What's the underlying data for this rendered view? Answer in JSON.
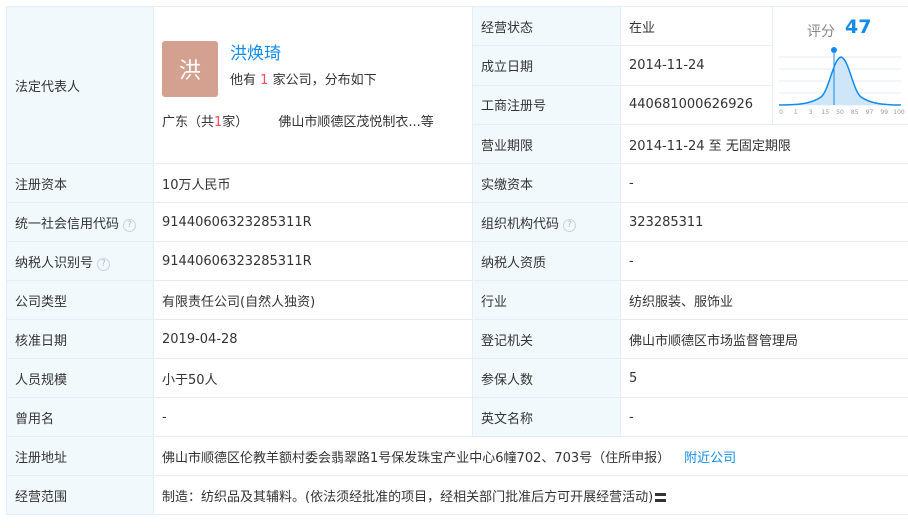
{
  "legal_rep": {
    "label": "法定代表人",
    "avatar_char": "洪",
    "name": "洪焕琦",
    "desc_prefix": "他有",
    "desc_count": "1",
    "desc_suffix": "家公司，分布如下",
    "province_prefix": "广东（共",
    "province_count": "1",
    "province_suffix": "家）",
    "company": "佛山市顺德区茂悦制衣...等"
  },
  "score": {
    "label": "评分",
    "value": "47",
    "ticks": [
      "0",
      "1",
      "3",
      "15",
      "50",
      "85",
      "97",
      "99",
      "100"
    ]
  },
  "fields": {
    "status_label": "经营状态",
    "status": "在业",
    "est_date_label": "成立日期",
    "est_date": "2014-11-24",
    "reg_no_label": "工商注册号",
    "reg_no": "440681000626926",
    "term_label": "营业期限",
    "term": "2014-11-24  至  无固定期限",
    "capital_label": "注册资本",
    "capital": "10万人民币",
    "paid_label": "实缴资本",
    "paid": "-",
    "credit_label": "统一社会信用代码",
    "credit": "91440606323285311R",
    "org_label": "组织机构代码",
    "org": "323285311",
    "tax_label": "纳税人识别号",
    "tax": "91440606323285311R",
    "taxq_label": "纳税人资质",
    "taxq": "-",
    "type_label": "公司类型",
    "type": "有限责任公司(自然人独资)",
    "industry_label": "行业",
    "industry": "纺织服装、服饰业",
    "approve_label": "核准日期",
    "approve": "2019-04-28",
    "authority_label": "登记机关",
    "authority": "佛山市顺德区市场监督管理局",
    "staff_label": "人员规模",
    "staff": "小于50人",
    "insured_label": "参保人数",
    "insured": "5",
    "former_label": "曾用名",
    "former": "-",
    "english_label": "英文名称",
    "english": "-",
    "address_label": "注册地址",
    "address": "佛山市顺德区伦教羊额村委会翡翠路1号保发珠宝产业中心6幢702、703号（住所申报）",
    "nearby_link": "附近公司",
    "scope_label": "经营范围",
    "scope": "制造：纺织品及其辅料。(依法须经批准的项目，经相关部门批准后方可开展经营活动)"
  },
  "help_icon": "question-circle-icon",
  "colors": {
    "accent": "#128bed",
    "highlight": "#fd485e",
    "label_bg": "#f2f9fc",
    "avatar_bg": "#d4a08f"
  }
}
